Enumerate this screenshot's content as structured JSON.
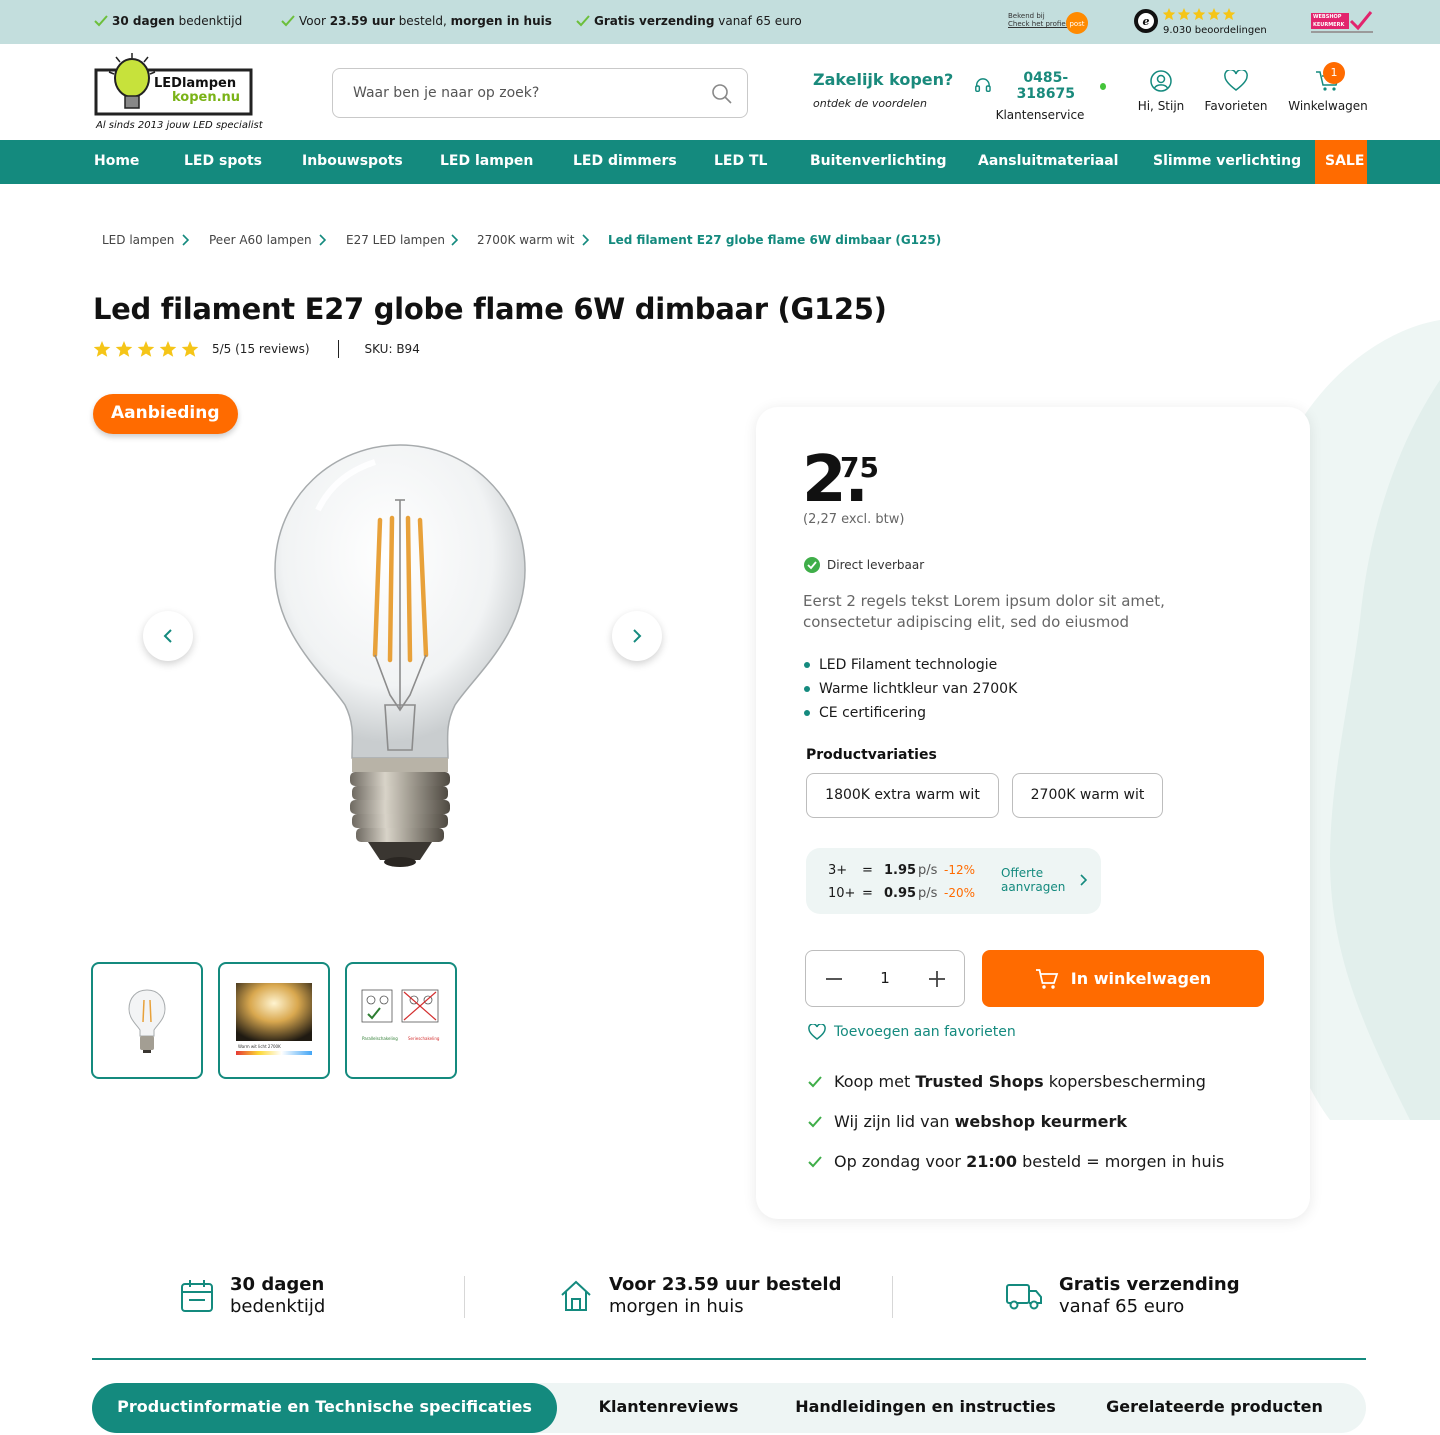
{
  "topbar": {
    "usps": [
      {
        "bold": "30 dagen",
        "rest": " bedenktijd"
      },
      {
        "pre": "Voor ",
        "bold": "23.59",
        "mid": " uur",
        "rest": " besteld, ",
        "bold2": "morgen in huis"
      },
      {
        "bold": "Gratis verzending",
        "rest": " vanaf 65 euro"
      }
    ],
    "postnl_line1": "Bekend bij",
    "postnl_line2": "Check het profiel",
    "reviews_count": "9.030 beoordelingen",
    "keurmerk_label": "WEBSHOP KEURMERK"
  },
  "header": {
    "logo_line1": "LEDlampen",
    "logo_line2": "kopen.nu",
    "logo_tagline": "Al sinds 2013 jouw LED specialist",
    "search_placeholder": "Waar ben je naar op zoek?",
    "business_title": "Zakelijk kopen?",
    "business_sub": "ontdek de voordelen",
    "phone": "0485-318675",
    "service_label": "Klantenservice",
    "account_label": "Hi, Stijn",
    "favorites_label": "Favorieten",
    "cart_label": "Winkelwagen",
    "cart_count": "1"
  },
  "nav": [
    "Home",
    "LED spots",
    "Inbouwspots",
    "LED lampen",
    "LED dimmers",
    "LED TL",
    "Buitenverlichting",
    "Aansluitmateriaal",
    "Slimme verlichting",
    "SALE"
  ],
  "breadcrumb": [
    "LED lampen",
    "Peer A60 lampen",
    "E27 LED lampen",
    "2700K warm wit",
    "Led filament E27 globe flame 6W dimbaar (G125)"
  ],
  "product": {
    "title": "Led filament E27 globe flame 6W dimbaar (G125)",
    "rating_text": "5/5 (15 reviews)",
    "rating_value": 5,
    "sku": "SKU: B94",
    "offer_badge": "Aanbieding",
    "price_int": "2",
    "price_dec": "75",
    "price_excl": "(2,27 excl. btw)",
    "stock": "Direct leverbaar",
    "intro": "Eerst 2 regels tekst Lorem ipsum dolor sit amet, consectetur adipiscing elit, sed do eiusmod",
    "features": [
      "LED Filament technologie",
      "Warme lichtkleur van 2700K",
      "CE certificering"
    ],
    "variations_label": "Productvariaties",
    "variations": [
      "1800K extra warm wit",
      "2700K warm wit"
    ],
    "tiers": [
      {
        "qty": "3+",
        "eq": "=",
        "price": "1.95",
        "unit": "p/s",
        "discount": "-12%"
      },
      {
        "qty": "10+",
        "eq": "=",
        "price": "0.95",
        "unit": "p/s",
        "discount": "-20%"
      }
    ],
    "quote_line1": "Offerte",
    "quote_line2": "aanvragen",
    "quantity": "1",
    "add_to_cart": "In winkelwagen",
    "add_favorite": "Toevoegen aan favorieten",
    "trust": [
      {
        "pre": "Koop met ",
        "bold": "Trusted Shops",
        "post": " kopersbescherming"
      },
      {
        "pre": "Wij zijn lid van ",
        "bold": "webshop keurmerk",
        "post": ""
      },
      {
        "pre": "Op zondag voor ",
        "bold": "21:00",
        "post": " besteld = morgen in huis"
      }
    ],
    "thumb2_caption": "Warm wit licht 2700K",
    "thumb3_caption_left": "Parallelschakeling",
    "thumb3_caption_right": "Serieschakeling"
  },
  "usp_row": [
    {
      "l1": "30 dagen",
      "l2": "bedenktijd"
    },
    {
      "l1": "Voor 23.59 uur besteld",
      "l2": "morgen in huis"
    },
    {
      "l1": "Gratis verzending",
      "l2": "vanaf 65 euro"
    }
  ],
  "tabs": [
    "Productinformatie en Technische specificaties",
    "Klantenreviews",
    "Handleidingen en instructies",
    "Gerelateerde producten"
  ],
  "colors": {
    "primary": "#148a7e",
    "accent": "#ff6b00",
    "topbar": "#c3dedd",
    "star": "#f5c518"
  }
}
